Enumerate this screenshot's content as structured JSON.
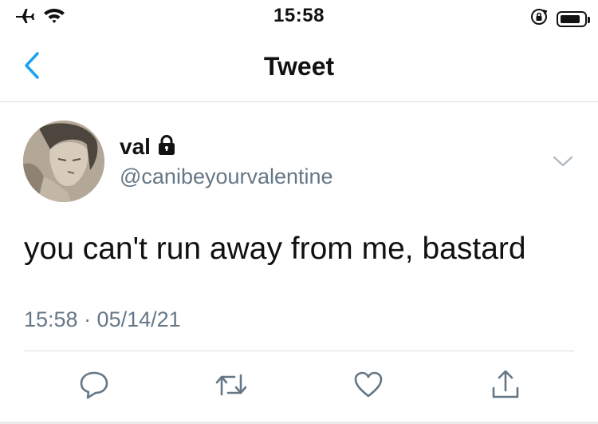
{
  "status_bar": {
    "time": "15:58",
    "icons": [
      "airplane-icon",
      "wifi-icon",
      "rotation-lock-icon",
      "battery-icon"
    ]
  },
  "nav": {
    "back_icon": "chevron-left-icon",
    "title": "Tweet"
  },
  "tweet": {
    "user": {
      "name": "val",
      "handle": "@canibeyourvalentine",
      "protected_icon": "lock-icon"
    },
    "text": "you can't run away from me, bastard",
    "meta": "15:58 · 05/14/21",
    "actions": [
      {
        "icon": "reply-icon"
      },
      {
        "icon": "retweet-icon"
      },
      {
        "icon": "like-icon"
      },
      {
        "icon": "share-icon"
      }
    ]
  },
  "colors": {
    "accent": "#1da1f2",
    "secondary_text": "#657786",
    "icon_gray": "#657786",
    "divider": "#d6d9dc"
  }
}
